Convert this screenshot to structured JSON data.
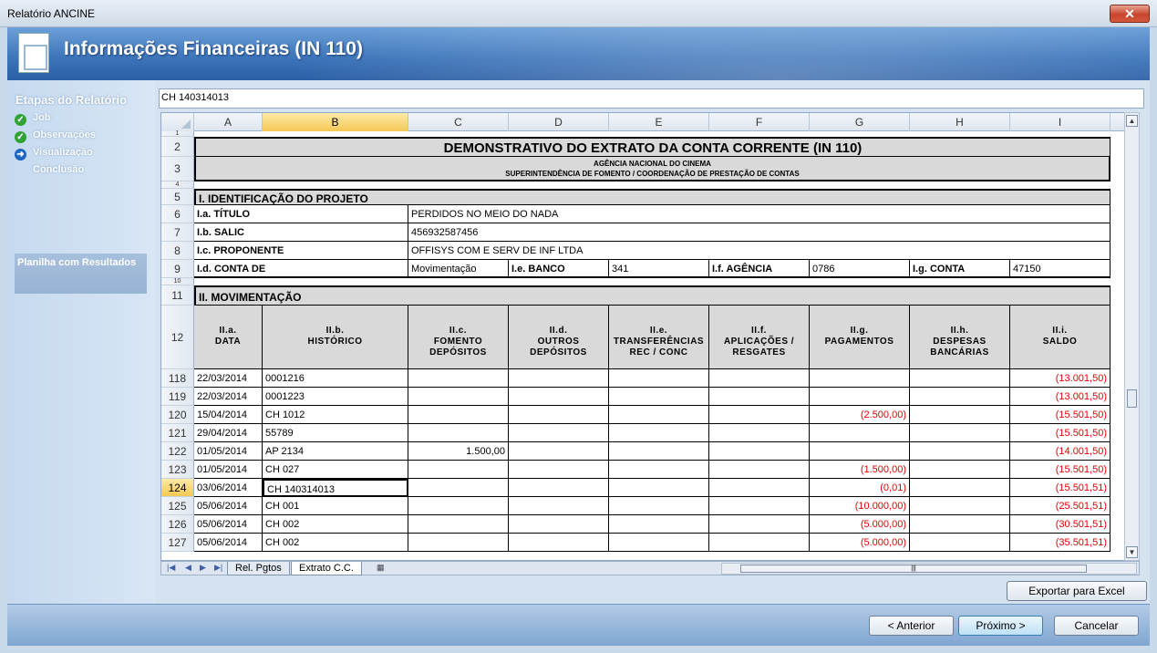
{
  "window": {
    "title": "Relatório ANCINE"
  },
  "banner": {
    "title": "Informações Financeiras (IN 110)"
  },
  "sidebar": {
    "heading": "Etapas do Relatório",
    "steps": [
      {
        "label": "Job",
        "state": "done"
      },
      {
        "label": "Observações",
        "state": "done"
      },
      {
        "label": "Visualização",
        "state": "current"
      },
      {
        "label": "Conclusão",
        "state": "pending"
      }
    ],
    "panel": "Planilha com Resultados"
  },
  "formula_bar": {
    "value": "CH 140314013"
  },
  "columns": [
    "A",
    "B",
    "C",
    "D",
    "E",
    "F",
    "G",
    "H",
    "I"
  ],
  "selected_column": "B",
  "selected_row": "124",
  "rows": [
    "1",
    "2",
    "3",
    "4",
    "5",
    "6",
    "7",
    "8",
    "9",
    "10",
    "11",
    "12",
    "118",
    "119",
    "120",
    "121",
    "122",
    "123",
    "124",
    "125",
    "126",
    "127"
  ],
  "sheet": {
    "title": "DEMONSTRATIVO DO EXTRATO DA CONTA CORRENTE (IN 110)",
    "sub1": "AGÊNCIA NACIONAL DO CINEMA",
    "sub2": "SUPERINTENDÊNCIA DE FOMENTO / COORDENAÇÃO DE PRESTAÇÃO DE CONTAS",
    "sec1": "I. IDENTIFICAÇÃO DO PROJETO",
    "titulo_l": "I.a. TÍTULO",
    "titulo_v": "PERDIDOS NO MEIO DO NADA",
    "salic_l": "I.b. SALIC",
    "salic_v": "456932587456",
    "prop_l": "I.c. PROPONENTE",
    "prop_v": "OFFISYS COM E SERV DE INF LTDA",
    "conta_l": "I.d. CONTA DE",
    "conta_v": "Movimentação",
    "banco_l": "I.e. BANCO",
    "banco_v": "341",
    "agencia_l": "I.f. AGÊNCIA",
    "agencia_v": "0786",
    "gconta_l": "I.g. CONTA",
    "gconta_v": "47150",
    "sec2": "II. MOVIMENTAÇÃO",
    "headers": [
      [
        "II.a.",
        "DATA",
        ""
      ],
      [
        "II.b.",
        "HISTÓRICO",
        ""
      ],
      [
        "II.c.",
        "FOMENTO",
        "DEPÓSITOS"
      ],
      [
        "II.d.",
        "OUTROS",
        "DEPÓSITOS"
      ],
      [
        "II.e.",
        "TRANSFERÊNCIAS",
        "REC / CONC"
      ],
      [
        "II.f.",
        "APLICAÇÕES /",
        "RESGATES"
      ],
      [
        "II.g.",
        "PAGAMENTOS",
        ""
      ],
      [
        "II.h.",
        "DESPESAS",
        "BANCÁRIAS"
      ],
      [
        "II.i.",
        "SALDO",
        ""
      ]
    ],
    "data": [
      {
        "row": "118",
        "date": "22/03/2014",
        "hist": "0001216",
        "fom": "",
        "outros": "",
        "transf": "",
        "aplic": "",
        "pag": "",
        "desp": "",
        "saldo": "(13.001,50)"
      },
      {
        "row": "119",
        "date": "22/03/2014",
        "hist": "0001223",
        "fom": "",
        "outros": "",
        "transf": "",
        "aplic": "",
        "pag": "",
        "desp": "",
        "saldo": "(13.001,50)"
      },
      {
        "row": "120",
        "date": "15/04/2014",
        "hist": "CH 1012",
        "fom": "",
        "outros": "",
        "transf": "",
        "aplic": "",
        "pag": "(2.500,00)",
        "desp": "",
        "saldo": "(15.501,50)"
      },
      {
        "row": "121",
        "date": "29/04/2014",
        "hist": "55789",
        "fom": "",
        "outros": "",
        "transf": "",
        "aplic": "",
        "pag": "",
        "desp": "",
        "saldo": "(15.501,50)"
      },
      {
        "row": "122",
        "date": "01/05/2014",
        "hist": "AP 2134",
        "fom": "1.500,00",
        "outros": "",
        "transf": "",
        "aplic": "",
        "pag": "",
        "desp": "",
        "saldo": "(14.001,50)"
      },
      {
        "row": "123",
        "date": "01/05/2014",
        "hist": "CH 027",
        "fom": "",
        "outros": "",
        "transf": "",
        "aplic": "",
        "pag": "(1.500,00)",
        "desp": "",
        "saldo": "(15.501,50)"
      },
      {
        "row": "124",
        "date": "03/06/2014",
        "hist": "CH 140314013",
        "fom": "",
        "outros": "",
        "transf": "",
        "aplic": "",
        "pag": "(0,01)",
        "desp": "",
        "saldo": "(15.501,51)"
      },
      {
        "row": "125",
        "date": "05/06/2014",
        "hist": "CH 001",
        "fom": "",
        "outros": "",
        "transf": "",
        "aplic": "",
        "pag": "(10.000,00)",
        "desp": "",
        "saldo": "(25.501,51)"
      },
      {
        "row": "126",
        "date": "05/06/2014",
        "hist": "CH 002",
        "fom": "",
        "outros": "",
        "transf": "",
        "aplic": "",
        "pag": "(5.000,00)",
        "desp": "",
        "saldo": "(30.501,51)"
      },
      {
        "row": "127",
        "date": "05/06/2014",
        "hist": "CH 002",
        "fom": "",
        "outros": "",
        "transf": "",
        "aplic": "",
        "pag": "(5.000,00)",
        "desp": "",
        "saldo": "(35.501,51)"
      }
    ]
  },
  "sheet_tabs": [
    {
      "label": "Rel. Pgtos",
      "active": false
    },
    {
      "label": "Extrato C.C.",
      "active": true
    }
  ],
  "buttons": {
    "export": "Exportar para Excel",
    "back": "< Anterior",
    "next": "Próximo >",
    "cancel": "Cancelar"
  },
  "colors": {
    "negative": "#e00000",
    "banner": "#3b73b9",
    "header_fill": "#d9d9d9"
  }
}
